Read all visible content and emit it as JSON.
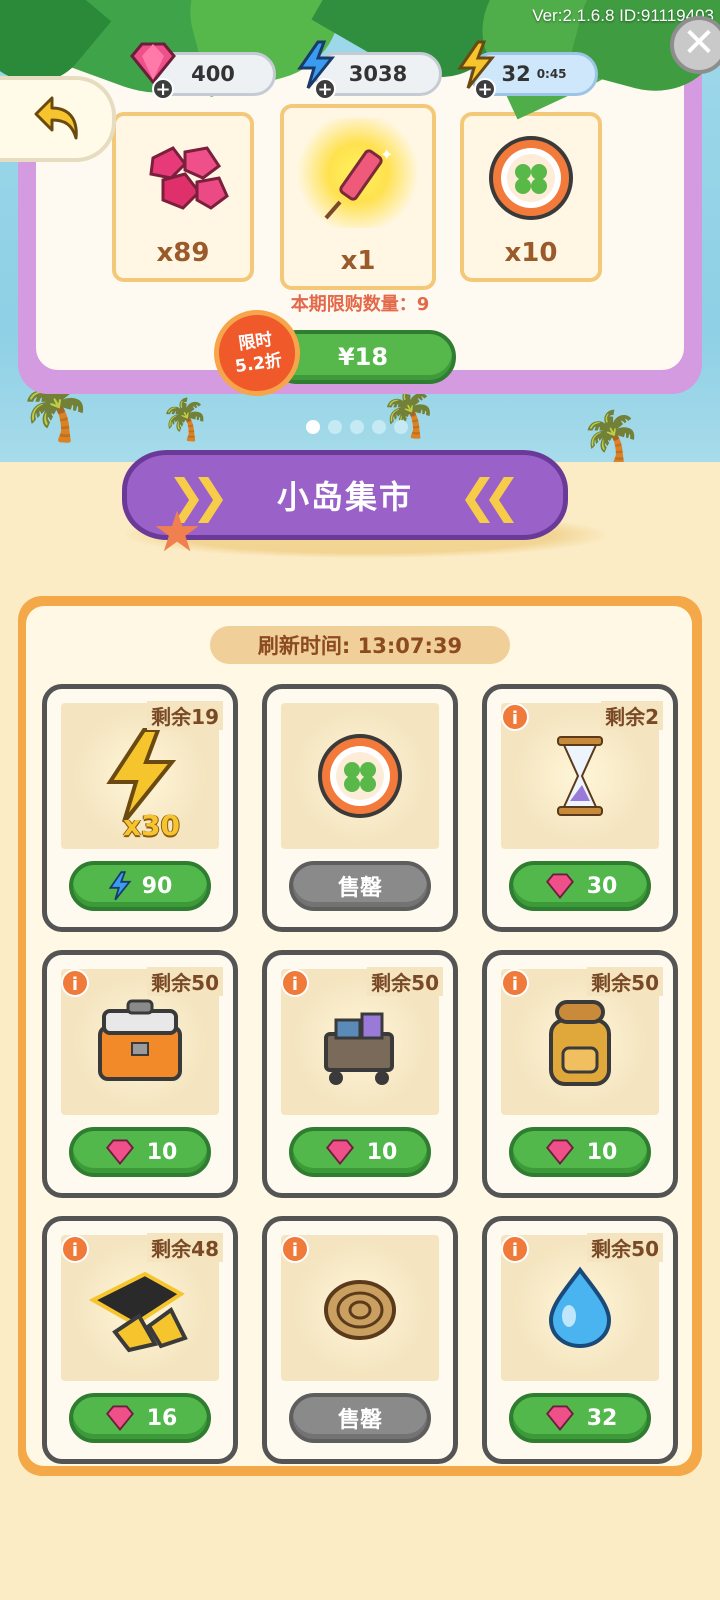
{
  "version_text": "Ver:2.1.6.8 ID:91119403",
  "resources": {
    "gems": "400",
    "energy": "3038",
    "stamina": "32",
    "stamina_timer": "0:45"
  },
  "pack": {
    "items": [
      {
        "qty": "x89",
        "icon": "gem-cluster-icon"
      },
      {
        "qty": "x1",
        "icon": "firework-rocket-icon"
      },
      {
        "qty": "x10",
        "icon": "clover-coin-icon"
      }
    ],
    "limit_text": "本期限购数量：9",
    "price": "¥18",
    "discount_line1": "限时",
    "discount_line2": "5.2折"
  },
  "carousel": {
    "pages": 5,
    "active": 0
  },
  "market": {
    "title": "小岛集市",
    "refresh_label": "刷新时间: 13:07:39",
    "items": [
      {
        "icon": "lightning-icon",
        "remain": "剩余19",
        "qty": "x30",
        "price": "90",
        "currency": "energy",
        "sold": false,
        "info": false
      },
      {
        "icon": "clover-coin-icon",
        "remain": "",
        "price": "售罄",
        "currency": "",
        "sold": true,
        "info": false
      },
      {
        "icon": "hourglass-icon",
        "remain": "剩余2",
        "price": "30",
        "currency": "gem",
        "sold": false,
        "info": true
      },
      {
        "icon": "toolbox-icon",
        "remain": "剩余50",
        "price": "10",
        "currency": "gem",
        "sold": false,
        "info": true
      },
      {
        "icon": "cart-icon",
        "remain": "剩余50",
        "price": "10",
        "currency": "gem",
        "sold": false,
        "info": true
      },
      {
        "icon": "backpack-icon",
        "remain": "剩余50",
        "price": "10",
        "currency": "gem",
        "sold": false,
        "info": true
      },
      {
        "icon": "flippers-icon",
        "remain": "剩余48",
        "price": "16",
        "currency": "gem",
        "sold": false,
        "info": true
      },
      {
        "icon": "rope-icon",
        "remain": "",
        "price": "售罄",
        "currency": "",
        "sold": true,
        "info": true
      },
      {
        "icon": "water-drop-icon",
        "remain": "剩余50",
        "price": "32",
        "currency": "gem",
        "sold": false,
        "info": true
      }
    ]
  },
  "colors": {
    "accent_green": "#52b84c",
    "panel_orange": "#f5a848",
    "banner_purple": "#9a62c8",
    "sold_grey": "#8a8a8a"
  }
}
